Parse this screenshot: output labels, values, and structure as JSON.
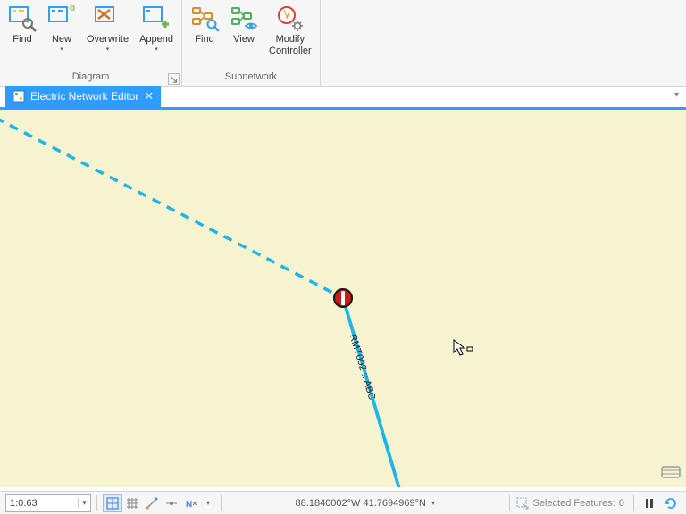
{
  "ribbon": {
    "groups": [
      {
        "name": "diagram",
        "label": "Diagram",
        "hasCorner": true,
        "buttons": [
          {
            "name": "find-diagram",
            "label": "Find",
            "hasDropdown": false,
            "iconColor1": "#35a0e8",
            "iconColor2": "#f5c242"
          },
          {
            "name": "new-diagram",
            "label": "New",
            "hasDropdown": true,
            "iconColor1": "#35a0e8",
            "iconColor2": "#6fb64a"
          },
          {
            "name": "overwrite-diagram",
            "label": "Overwrite",
            "hasDropdown": true,
            "iconColor1": "#35a0e8",
            "iconColor2": "#d07030"
          },
          {
            "name": "append-diagram",
            "label": "Append",
            "hasDropdown": true,
            "iconColor1": "#35a0e8",
            "iconColor2": "#6fb64a"
          }
        ]
      },
      {
        "name": "subnetwork",
        "label": "Subnetwork",
        "hasCorner": false,
        "buttons": [
          {
            "name": "find-subnetwork",
            "label": "Find",
            "hasDropdown": false,
            "iconColor1": "#d28f2f",
            "iconColor2": "#35a0e8"
          },
          {
            "name": "view-subnetwork",
            "label": "View",
            "hasDropdown": false,
            "iconColor1": "#4fb060",
            "iconColor2": "#35a0e8"
          },
          {
            "name": "modify-controller",
            "label": "Modify\nController",
            "hasDropdown": false,
            "iconColor1": "#e23b3b",
            "iconColor2": "#888"
          }
        ]
      }
    ]
  },
  "tab": {
    "title": "Electric Network Editor"
  },
  "map": {
    "featureLabel": "RMT002 :: ABC"
  },
  "statusbar": {
    "scale": "1:0.63",
    "coords": "88.1840002°W 41.7694969°N",
    "selectedLabel": "Selected Features:",
    "selectedCount": "0"
  }
}
